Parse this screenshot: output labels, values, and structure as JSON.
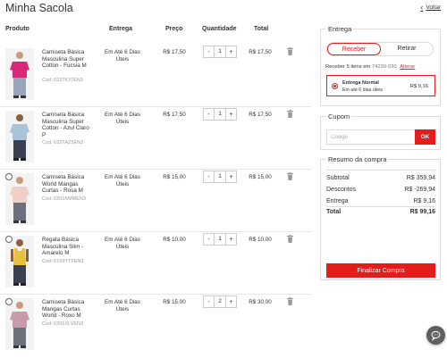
{
  "header": {
    "title": "Minha Sacola",
    "back_label": "Voltar"
  },
  "cart_columns": {
    "product": "Produto",
    "delivery": "Entrega",
    "price": "Preço",
    "quantity": "Quantidade",
    "total": "Total"
  },
  "cart_items": [
    {
      "name": "Camiseta Básica Masculina Super Cotton - Fúcsia M",
      "code": "Cod: 0227K37EN3",
      "delivery": "Em Até 6 Dias Úteis",
      "price": "R$ 17,50",
      "quantity": "1",
      "total": "R$ 17,50",
      "shirt_color": "#d8287a",
      "has_zoom": false
    },
    {
      "name": "Camiseta Básica Masculina Super Cotton - Azul Claro P",
      "code": "Cod: 0227AZ5EN2",
      "delivery": "Em Até 6 Dias Úteis",
      "price": "R$ 17,50",
      "quantity": "1",
      "total": "R$ 17,50",
      "shirt_color": "#a9c3d9",
      "has_zoom": false
    },
    {
      "name": "Camiseta Básica World Mangas Curtas - Rosa M",
      "code": "Cod: 0201KMMEN3",
      "delivery": "Em Até 6 Dias Úteis",
      "price": "R$ 15,00",
      "quantity": "1",
      "total": "R$ 15,00",
      "shirt_color": "#efcfc6",
      "has_zoom": true
    },
    {
      "name": "Regata Básica Masculina Slim - Amarelo M",
      "code": "Cod: 0199YTFEN3",
      "delivery": "Em Até 6 Dias Úteis",
      "price": "R$ 10,00",
      "quantity": "1",
      "total": "R$ 10,00",
      "shirt_color": "#e7c23a",
      "has_zoom": true
    },
    {
      "name": "Camiseta Básica Mangas Curtas World - Roxo M",
      "code": "Cod: 0201XLVEN3",
      "delivery": "Em Até 6 Dias Úteis",
      "price": "R$ 15,00",
      "quantity": "2",
      "total": "R$ 30,00",
      "shirt_color": "#c99aab",
      "has_zoom": true
    }
  ],
  "delivery_box": {
    "title": "Entrega",
    "tab_receive": "Receber",
    "tab_pickup": "Retirar",
    "receive_text": "Receber 5 itens em",
    "cep": "74230-030",
    "alter_label": "Alterar",
    "option_name": "Entrega Normal",
    "option_days": "Em até 6 dias úteis",
    "option_price": "R$ 9,16"
  },
  "coupon_box": {
    "title": "Cupom",
    "placeholder": "Código",
    "ok_label": "OK"
  },
  "summary": {
    "title": "Resumo da compra",
    "subtotal_label": "Subtotal",
    "subtotal_value": "R$ 359,94",
    "discount_label": "Descontos",
    "discount_value": "R$ -269,94",
    "delivery_label": "Entrega",
    "delivery_value": "R$ 9,16",
    "total_label": "Total",
    "total_value": "R$ 99,16",
    "finish_label": "Finalizar Compra"
  },
  "colors": {
    "accent": "#e31c1c",
    "text": "#333333",
    "muted": "#9a9a9a",
    "border": "#dddddd"
  },
  "icons": {
    "back": "chevron-left-icon",
    "delete": "trash-icon",
    "zoom": "zoom-icon",
    "chat": "chat-bubble-icon"
  }
}
